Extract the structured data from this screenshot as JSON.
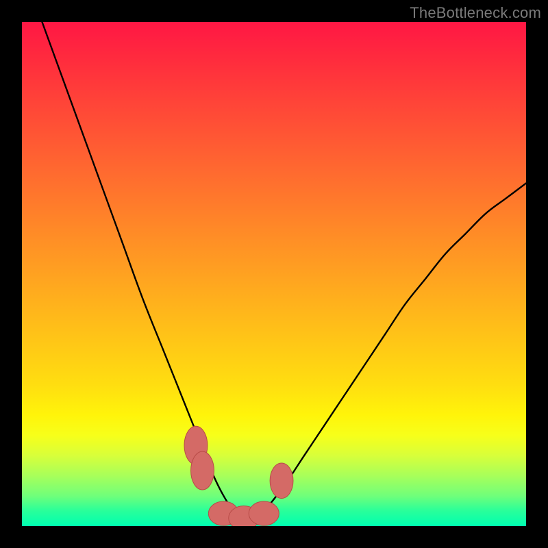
{
  "watermark": "TheBottleneck.com",
  "colors": {
    "frame": "#000000",
    "curve": "#000000",
    "marker_fill": "#d46a66",
    "marker_stroke": "#b84b47"
  },
  "chart_data": {
    "type": "line",
    "title": "",
    "xlabel": "",
    "ylabel": "",
    "xlim": [
      0,
      100
    ],
    "ylim": [
      0,
      100
    ],
    "grid": false,
    "curve_note": "V-shaped bottleneck curve; values are estimated from pixel positions (no axis ticks shown).",
    "series": [
      {
        "name": "bottleneck-curve",
        "x": [
          4,
          8,
          12,
          16,
          20,
          24,
          28,
          30,
          32,
          34,
          36,
          38,
          40,
          42,
          44,
          46,
          48,
          52,
          56,
          60,
          64,
          68,
          72,
          76,
          80,
          84,
          88,
          92,
          96,
          100
        ],
        "y": [
          100,
          89,
          78,
          67,
          56,
          45,
          35,
          30,
          25,
          20,
          15,
          10,
          6,
          3,
          1.5,
          1.5,
          3,
          8,
          14,
          20,
          26,
          32,
          38,
          44,
          49,
          54,
          58,
          62,
          65,
          68
        ]
      }
    ],
    "markers": [
      {
        "name": "left-marker-upper",
        "x": 34.5,
        "y": 16,
        "rx": 2.3,
        "ry": 3.8
      },
      {
        "name": "left-marker-lower",
        "x": 35.8,
        "y": 11,
        "rx": 2.3,
        "ry": 3.8
      },
      {
        "name": "trough-marker-1",
        "x": 40,
        "y": 2.5,
        "rx": 3.0,
        "ry": 2.4
      },
      {
        "name": "trough-marker-2",
        "x": 44,
        "y": 1.6,
        "rx": 3.0,
        "ry": 2.4
      },
      {
        "name": "trough-marker-3",
        "x": 48,
        "y": 2.5,
        "rx": 3.0,
        "ry": 2.4
      },
      {
        "name": "right-marker",
        "x": 51.5,
        "y": 9,
        "rx": 2.3,
        "ry": 3.5
      }
    ]
  }
}
